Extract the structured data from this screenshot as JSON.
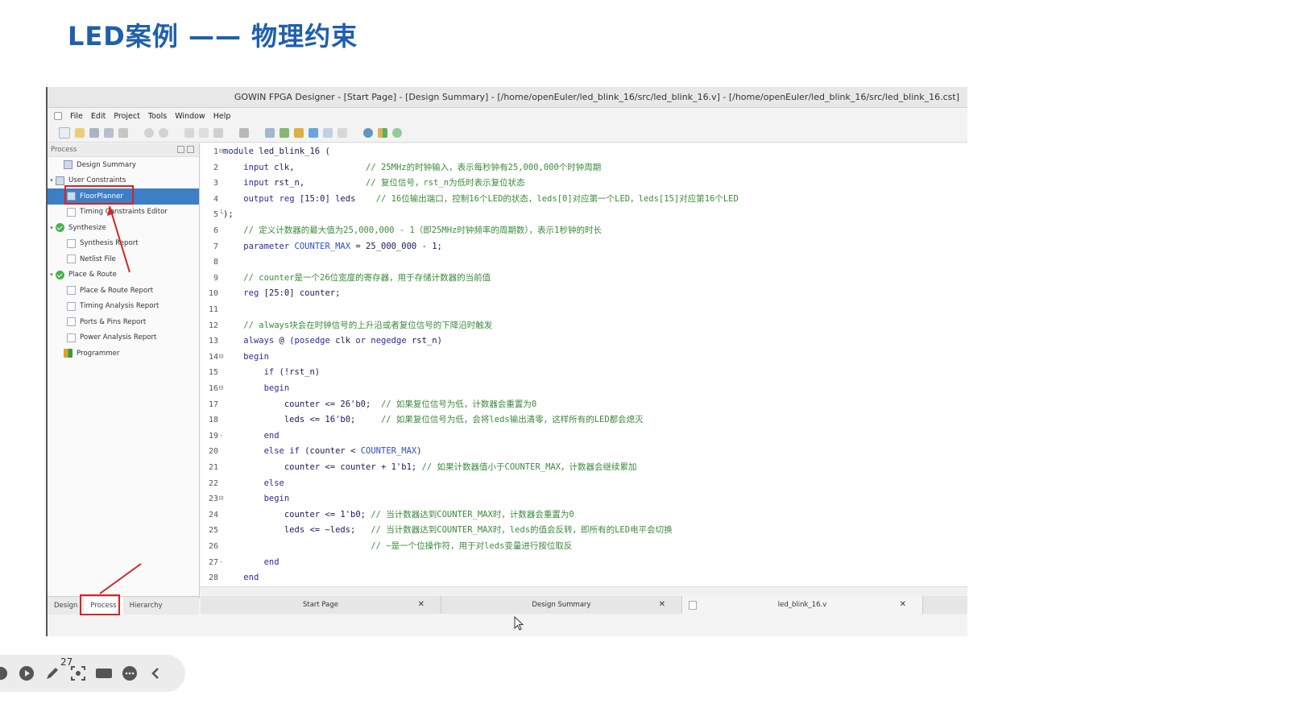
{
  "slide": {
    "title": "LED案例 —— 物理约束",
    "page_number": "27"
  },
  "window": {
    "title": "GOWIN FPGA Designer - [Start Page] - [Design Summary] - [/home/openEuler/led_blink_16/src/led_blink_16.v] - [/home/openEuler/led_blink_16/src/led_blink_16.cst]"
  },
  "menu": [
    "File",
    "Edit",
    "Project",
    "Tools",
    "Window",
    "Help"
  ],
  "process_panel": {
    "header": "Process",
    "items": [
      {
        "label": "Design Summary",
        "level": 1,
        "icon": "document-icon"
      },
      {
        "label": "User Constraints",
        "level": 0,
        "icon": "constraints-icon",
        "expanded": true
      },
      {
        "label": "FloorPlanner",
        "level": 1,
        "icon": "floorplanner-icon",
        "selected": true
      },
      {
        "label": "Timing Constraints Editor",
        "level": 1,
        "icon": "document-icon"
      },
      {
        "label": "Synthesize",
        "level": 0,
        "icon": "check-icon",
        "expanded": true
      },
      {
        "label": "Synthesis Report",
        "level": 1,
        "icon": "document-icon"
      },
      {
        "label": "Netlist File",
        "level": 1,
        "icon": "document-icon"
      },
      {
        "label": "Place & Route",
        "level": 0,
        "icon": "check-icon",
        "expanded": true
      },
      {
        "label": "Place & Route Report",
        "level": 1,
        "icon": "document-icon"
      },
      {
        "label": "Timing Analysis Report",
        "level": 1,
        "icon": "document-icon"
      },
      {
        "label": "Ports & Pins Report",
        "level": 1,
        "icon": "document-icon"
      },
      {
        "label": "Power Analysis Report",
        "level": 1,
        "icon": "document-icon"
      },
      {
        "label": "Programmer",
        "level": 0,
        "icon": "programmer-icon"
      }
    ],
    "tabs": [
      "Design",
      "Process",
      "Hierarchy"
    ],
    "active_tab": "Process"
  },
  "editor": {
    "lines": [
      {
        "n": "1",
        "fold": "⊟",
        "code": "module led_blink_16 ("
      },
      {
        "n": "2",
        "fold": "",
        "code": "    input clk,              // 25MHz的时钟输入，表示每秒钟有25,000,000个时钟周期"
      },
      {
        "n": "3",
        "fold": "",
        "code": "    input rst_n,            // 复位信号，rst_n为低时表示复位状态"
      },
      {
        "n": "4",
        "fold": "",
        "code": "    output reg [15:0] leds    // 16位输出端口，控制16个LED的状态，leds[0]对应第一个LED，leds[15]对应第16个LED"
      },
      {
        "n": "5",
        "fold": "└",
        "code": ");"
      },
      {
        "n": "6",
        "fold": "",
        "code": "    // 定义计数器的最大值为25,000,000 - 1（即25MHz时钟频率的周期数），表示1秒钟的时长"
      },
      {
        "n": "7",
        "fold": "",
        "code": "    parameter COUNTER_MAX = 25_000_000 - 1;"
      },
      {
        "n": "8",
        "fold": "",
        "code": ""
      },
      {
        "n": "9",
        "fold": "",
        "code": "    // counter是一个26位宽度的寄存器，用于存储计数器的当前值"
      },
      {
        "n": "10",
        "fold": "",
        "code": "    reg [25:0] counter;"
      },
      {
        "n": "11",
        "fold": "",
        "code": ""
      },
      {
        "n": "12",
        "fold": "",
        "code": "    // always块会在时钟信号的上升沿或者复位信号的下降沿时触发"
      },
      {
        "n": "13",
        "fold": "",
        "code": "    always @ (posedge clk or negedge rst_n)"
      },
      {
        "n": "14",
        "fold": "⊟",
        "code": "    begin"
      },
      {
        "n": "15",
        "fold": "",
        "code": "        if (!rst_n)"
      },
      {
        "n": "16",
        "fold": "⊟",
        "code": "        begin"
      },
      {
        "n": "17",
        "fold": "",
        "code": "            counter <= 26'b0;  // 如果复位信号为低，计数器会重置为0"
      },
      {
        "n": "18",
        "fold": "",
        "code": "            leds <= 16'b0;     // 如果复位信号为低，会将leds输出清零，这样所有的LED都会熄灭"
      },
      {
        "n": "19",
        "fold": "-",
        "code": "        end"
      },
      {
        "n": "20",
        "fold": "",
        "code": "        else if (counter < COUNTER_MAX)"
      },
      {
        "n": "21",
        "fold": "",
        "code": "            counter <= counter + 1'b1; // 如果计数器值小于COUNTER_MAX，计数器会继续累加"
      },
      {
        "n": "22",
        "fold": "",
        "code": "        else"
      },
      {
        "n": "23",
        "fold": "⊟",
        "code": "        begin"
      },
      {
        "n": "24",
        "fold": "",
        "code": "            counter <= 1'b0; // 当计数器达到COUNTER_MAX时，计数器会重置为0"
      },
      {
        "n": "25",
        "fold": "",
        "code": "            leds <= ~leds;   // 当计数器达到COUNTER_MAX时，leds的值会反转，即所有的LED电平会切换"
      },
      {
        "n": "26",
        "fold": "",
        "code": "                             // ~是一个位操作符，用于对leds变量进行按位取反"
      },
      {
        "n": "27",
        "fold": "-",
        "code": "        end"
      },
      {
        "n": "28",
        "fold": "",
        "code": "    end"
      }
    ]
  },
  "doc_tabs": [
    {
      "label": "Start Page"
    },
    {
      "label": "Design Summary"
    },
    {
      "label": "led_blink_16.v"
    }
  ],
  "colors": {
    "title": "#1f5fae",
    "selection": "#3d7fc4",
    "annotation": "#d42424",
    "comment": "#3b8b3b",
    "keyword": "#2b2b9a"
  }
}
